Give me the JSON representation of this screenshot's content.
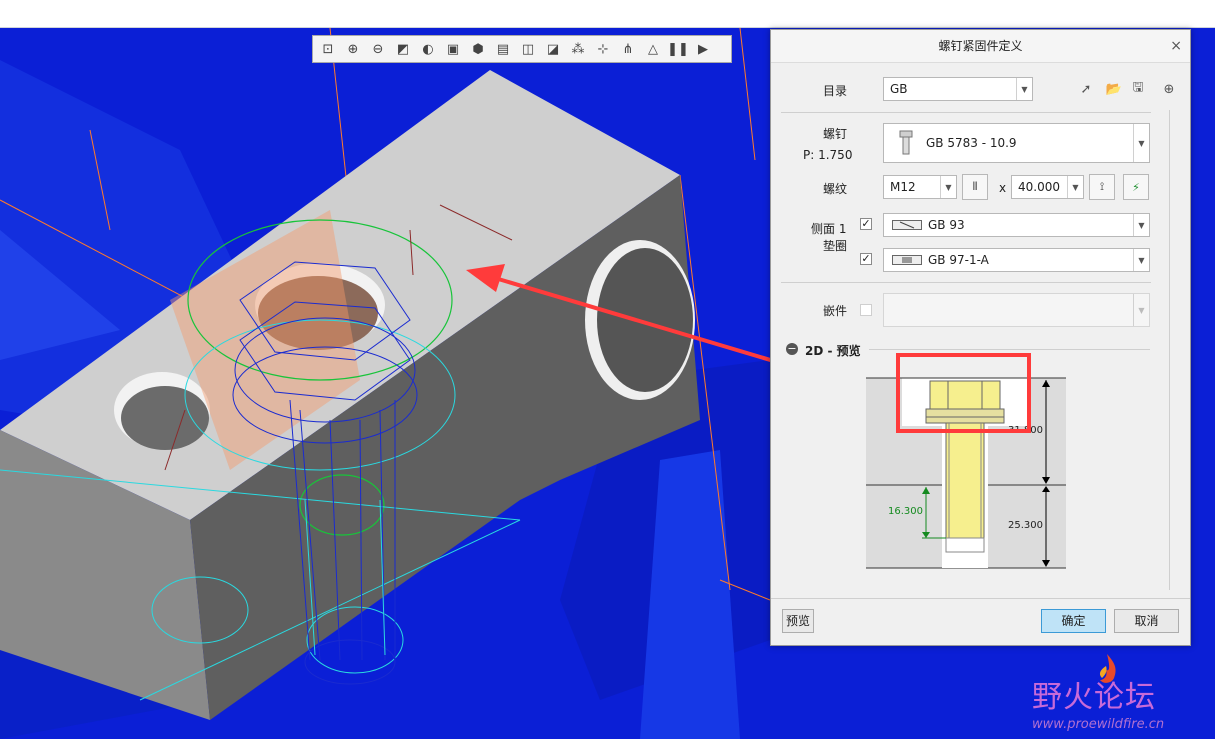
{
  "toolbar": {
    "buttons": [
      {
        "icon": "zoom-fit-icon",
        "glyph": "⊡"
      },
      {
        "icon": "zoom-in-icon",
        "glyph": "⊕"
      },
      {
        "icon": "zoom-out-icon",
        "glyph": "⊖"
      },
      {
        "icon": "refit-icon",
        "glyph": "◩"
      },
      {
        "icon": "repaint-icon",
        "glyph": "◐"
      },
      {
        "icon": "display-style-icon",
        "glyph": "▣"
      },
      {
        "icon": "saved-views-icon",
        "glyph": "⬢"
      },
      {
        "icon": "view-manager-icon",
        "glyph": "▤"
      },
      {
        "icon": "section-icon",
        "glyph": "◫"
      },
      {
        "icon": "datum-plane-icon",
        "glyph": "◪"
      },
      {
        "icon": "datum-axis-icon",
        "glyph": "⁂"
      },
      {
        "icon": "datum-point-icon",
        "glyph": "⊹"
      },
      {
        "icon": "csys-icon",
        "glyph": "⋔"
      },
      {
        "icon": "annotation-icon",
        "glyph": "△"
      },
      {
        "icon": "pause-icon",
        "glyph": "❚❚"
      },
      {
        "icon": "play-icon",
        "glyph": "▶"
      }
    ]
  },
  "dialog": {
    "title": "螺钉紧固件定义",
    "close_glyph": "×",
    "catalog": {
      "label": "目录",
      "value": "GB"
    },
    "screw": {
      "label": "螺钉",
      "pitch": "P: 1.750",
      "value": "GB 5783 - 10.9"
    },
    "thread": {
      "label": "螺纹",
      "size": "M12",
      "times": "x",
      "length": "40.000"
    },
    "washer": {
      "label_line1": "侧面 1",
      "label_line2": "垫圈",
      "row1": {
        "checked": true,
        "value": "GB 93"
      },
      "row2": {
        "checked": true,
        "value": "GB 97-1-A"
      }
    },
    "insert": {
      "label": "嵌件",
      "checked": false,
      "value": ""
    },
    "preview_section": {
      "collapse_glyph": "−",
      "title": "2D - 预览",
      "dim_total": "31.800",
      "dim_top": "16.300",
      "dim_thread": "25.300"
    },
    "buttons": {
      "preview": "预览",
      "ok": "确定",
      "cancel": "取消"
    }
  },
  "watermark": {
    "title": "野火论坛",
    "url": "www.proewildfire.cn"
  },
  "colors": {
    "viewport_blue": "#0b1fd6",
    "block_face": "#9e9e9e",
    "highlight_red": "#ff3b3b",
    "ok_button": "#bfe3f7"
  }
}
